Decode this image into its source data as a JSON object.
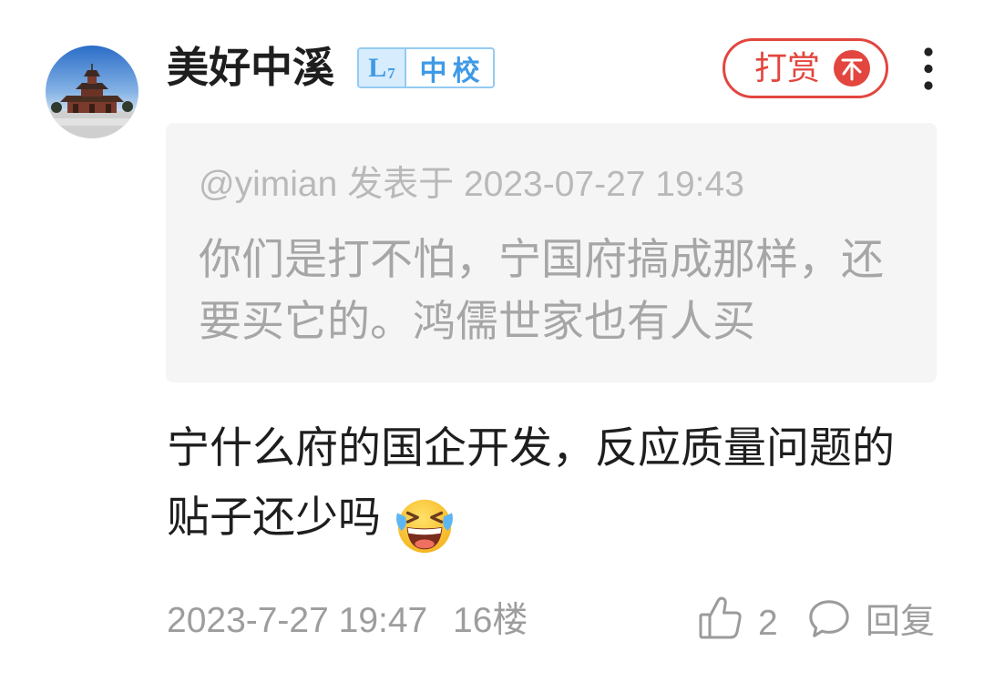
{
  "post": {
    "user": {
      "name": "美好中溪",
      "avatar_icon": "temple-photo-avatar",
      "level": {
        "prefix": "L",
        "number": "7",
        "title": "中校"
      }
    },
    "tip_button": {
      "label": "打赏",
      "icon": "coin-icon"
    },
    "more_icon": "more-vertical-icon",
    "quote": {
      "header": "@yimian 发表于 2023-07-27 19:43",
      "lines": [
        "你们是打不怕，宁国府搞成那样，还",
        "要买它的。鸿儒世家也有人买"
      ]
    },
    "content": {
      "lines": [
        "宁什么府的国企开发，反应质量问题的",
        "贴子还少吗"
      ],
      "emoji": "laughing-crying-face-icon"
    },
    "footer": {
      "timestamp": "2023-7-27 19:47",
      "floor": "16楼",
      "like_icon": "thumbs-up-icon",
      "like_count": "2",
      "reply_icon": "comment-bubble-icon",
      "reply_label": "回复"
    }
  },
  "colors": {
    "accent": "#e2463f",
    "badge-blue": "#3f9ae6",
    "badge-fill": "#d7ecfc",
    "badge-border": "#93cbf3",
    "quote-bg": "#f5f5f5",
    "quote-meta": "#b9b9b9",
    "quote-text": "#a6a6a6",
    "body-text": "#1e1e1e",
    "meta-text": "#9d9d9d",
    "icon-gray": "#9b9b9b"
  }
}
